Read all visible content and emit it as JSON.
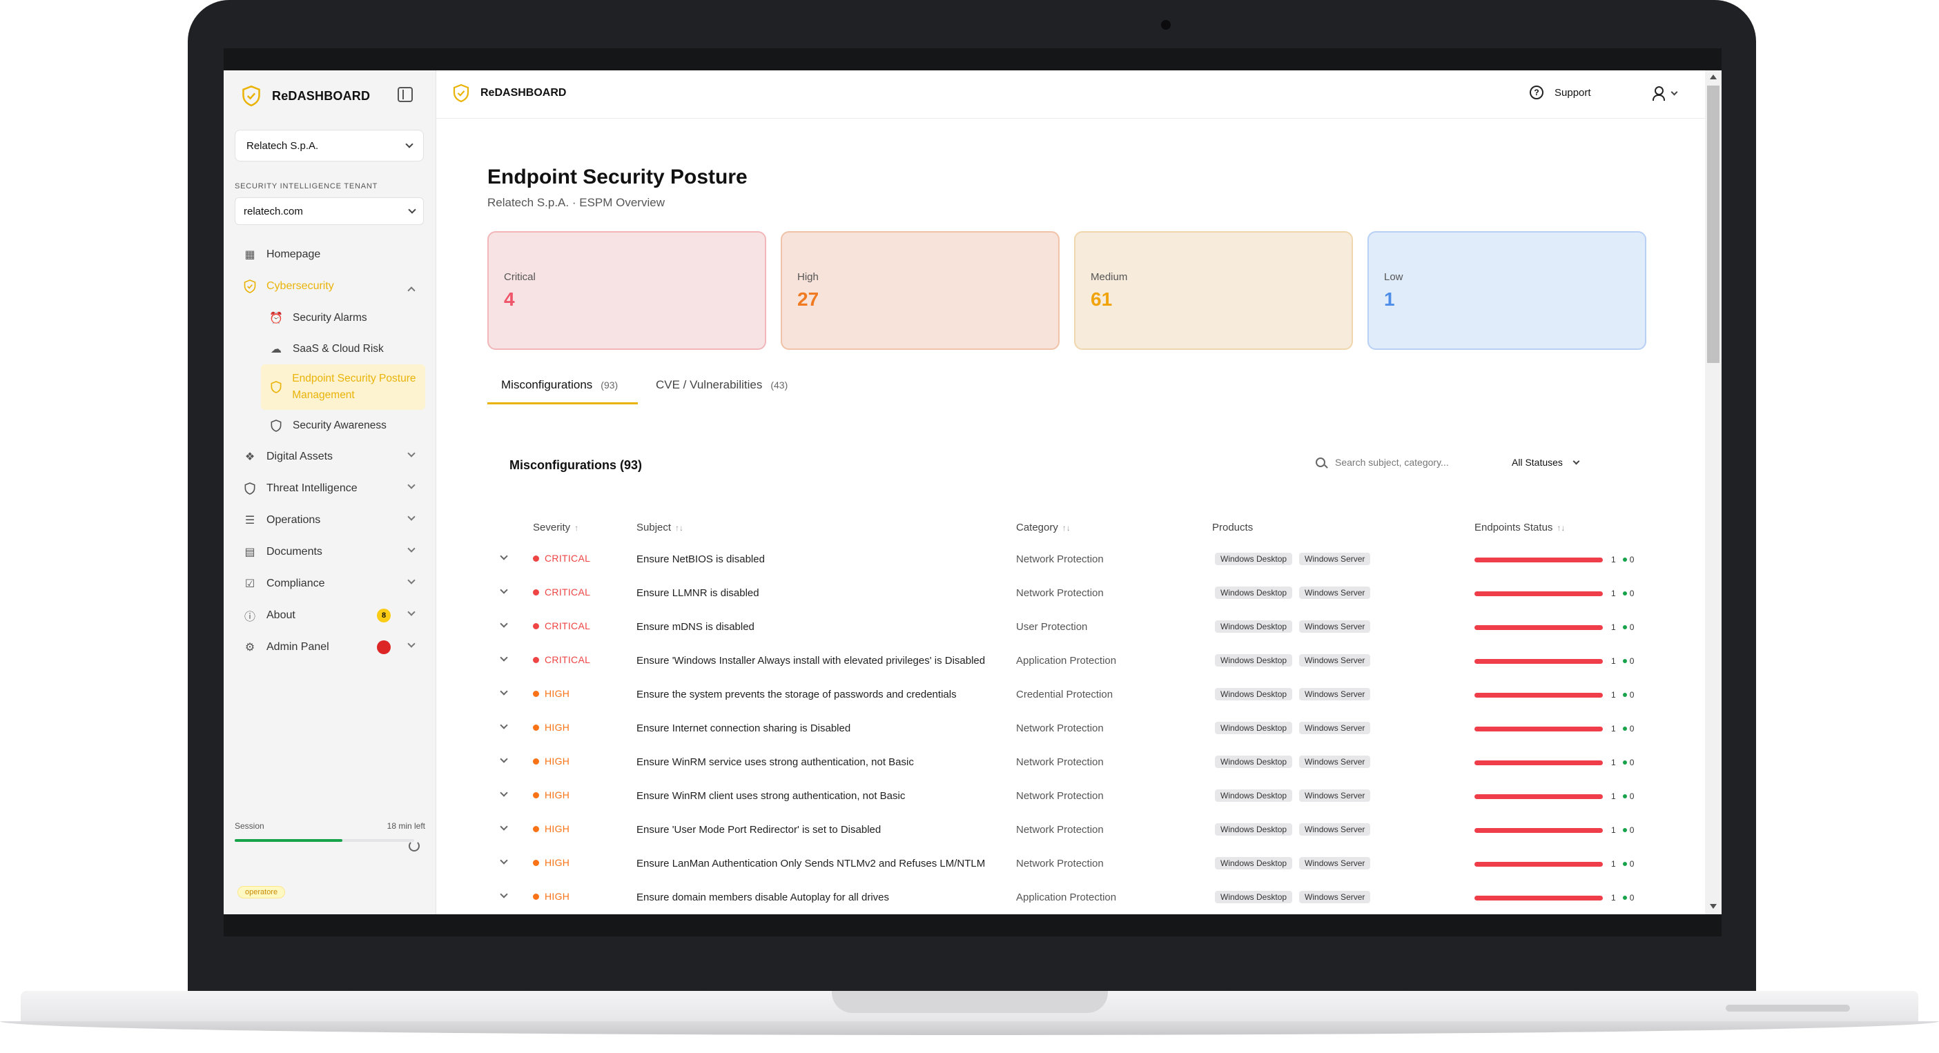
{
  "sidebar": {
    "brand": "ReDASHBOARD",
    "org": "Relatech S.p.A.",
    "tenant_label": "SECURITY INTELLIGENCE TENANT",
    "tenant_value": "relatech.com",
    "nav": [
      {
        "label": "Homepage",
        "icon": "grid-icon"
      },
      {
        "label": "Cybersecurity",
        "icon": "shield-check-icon"
      },
      {
        "label": "Digital Assets",
        "icon": "boxes-icon"
      },
      {
        "label": "Threat Intelligence",
        "icon": "shield-icon"
      },
      {
        "label": "Operations",
        "icon": "list-check-icon"
      },
      {
        "label": "Documents",
        "icon": "document-icon"
      },
      {
        "label": "Compliance",
        "icon": "checklist-icon"
      },
      {
        "label": "About",
        "icon": "info-icon",
        "badge": "8"
      },
      {
        "label": "Admin Panel",
        "icon": "sliders-icon",
        "badge": "!"
      }
    ],
    "sub_nav": [
      {
        "label": "Security Alarms",
        "icon": "alarm-icon"
      },
      {
        "label": "SaaS & Cloud Risk",
        "icon": "cloud-icon"
      },
      {
        "label": "Endpoint Security Posture Management",
        "icon": "shield-icon"
      },
      {
        "label": "Security Awareness",
        "icon": "shield-icon"
      }
    ],
    "session_label": "Session",
    "session_time": "18 min left",
    "session_progress": 0.6,
    "role": "operatore"
  },
  "topbar": {
    "brand": "ReDASHBOARD",
    "support": "Support"
  },
  "page": {
    "title": "Endpoint Security Posture",
    "subtitle": "Relatech S.p.A. · ESPM Overview"
  },
  "cards": [
    {
      "label": "Critical",
      "value": "4"
    },
    {
      "label": "High",
      "value": "27"
    },
    {
      "label": "Medium",
      "value": "61"
    },
    {
      "label": "Low",
      "value": "1"
    }
  ],
  "tabs": [
    {
      "label": "Misconfigurations",
      "count": "(93)"
    },
    {
      "label": "CVE / Vulnerabilities",
      "count": "(43)"
    }
  ],
  "section": {
    "title": "Misconfigurations (93)",
    "search_placeholder": "Search subject, category...",
    "status_filter": "All Statuses"
  },
  "table": {
    "headers": {
      "severity": "Severity",
      "subject": "Subject",
      "category": "Category",
      "products": "Products",
      "endpoints": "Endpoints Status"
    },
    "rows": [
      {
        "severity": "CRITICAL",
        "subject": "Ensure NetBIOS is disabled",
        "category": "Network Protection",
        "p1": "Windows Desktop",
        "p2": "Windows Server",
        "fail": "1",
        "pass": "0"
      },
      {
        "severity": "CRITICAL",
        "subject": "Ensure LLMNR is disabled",
        "category": "Network Protection",
        "p1": "Windows Desktop",
        "p2": "Windows Server",
        "fail": "1",
        "pass": "0"
      },
      {
        "severity": "CRITICAL",
        "subject": "Ensure mDNS is disabled",
        "category": "User Protection",
        "p1": "Windows Desktop",
        "p2": "Windows Server",
        "fail": "1",
        "pass": "0"
      },
      {
        "severity": "CRITICAL",
        "subject": "Ensure 'Windows Installer Always install with elevated privileges' is Disabled",
        "category": "Application Protection",
        "p1": "Windows Desktop",
        "p2": "Windows Server",
        "fail": "1",
        "pass": "0"
      },
      {
        "severity": "HIGH",
        "subject": "Ensure the system prevents the storage of passwords and credentials",
        "category": "Credential Protection",
        "p1": "Windows Desktop",
        "p2": "Windows Server",
        "fail": "1",
        "pass": "0"
      },
      {
        "severity": "HIGH",
        "subject": "Ensure Internet connection sharing is Disabled",
        "category": "Network Protection",
        "p1": "Windows Desktop",
        "p2": "Windows Server",
        "fail": "1",
        "pass": "0"
      },
      {
        "severity": "HIGH",
        "subject": "Ensure WinRM service uses strong authentication, not Basic",
        "category": "Network Protection",
        "p1": "Windows Desktop",
        "p2": "Windows Server",
        "fail": "1",
        "pass": "0"
      },
      {
        "severity": "HIGH",
        "subject": "Ensure WinRM client uses strong authentication, not Basic",
        "category": "Network Protection",
        "p1": "Windows Desktop",
        "p2": "Windows Server",
        "fail": "1",
        "pass": "0"
      },
      {
        "severity": "HIGH",
        "subject": "Ensure 'User Mode Port Redirector' is set to Disabled",
        "category": "Network Protection",
        "p1": "Windows Desktop",
        "p2": "Windows Server",
        "fail": "1",
        "pass": "0"
      },
      {
        "severity": "HIGH",
        "subject": "Ensure LanMan Authentication Only Sends NTLMv2 and Refuses LM/NTLM",
        "category": "Network Protection",
        "p1": "Windows Desktop",
        "p2": "Windows Server",
        "fail": "1",
        "pass": "0"
      },
      {
        "severity": "HIGH",
        "subject": "Ensure domain members disable Autoplay for all drives",
        "category": "Application Protection",
        "p1": "Windows Desktop",
        "p2": "Windows Server",
        "fail": "1",
        "pass": "0"
      }
    ]
  },
  "colors": {
    "accent": "#eab308",
    "critical": "#ef4444",
    "high": "#f97316",
    "medium": "#f0a30a",
    "low": "#4f8ee8"
  }
}
